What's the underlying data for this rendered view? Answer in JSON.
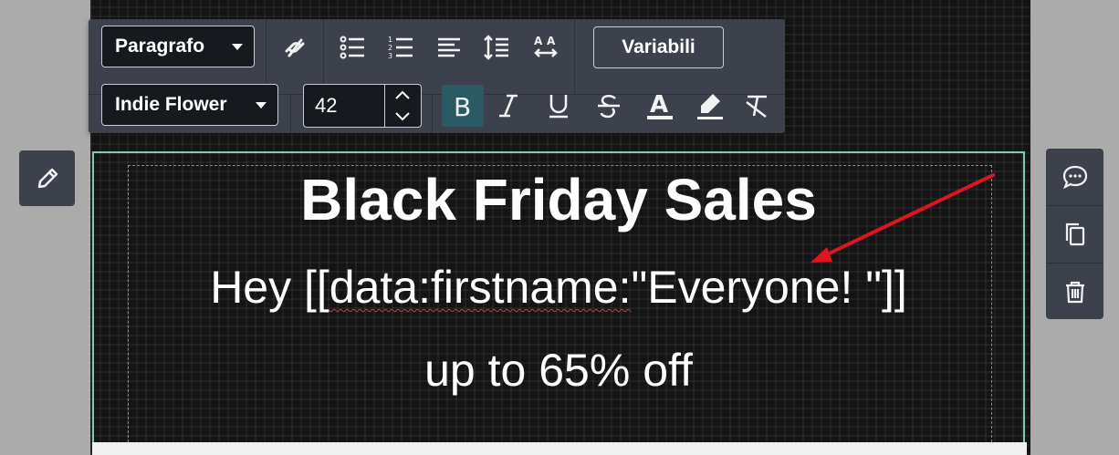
{
  "toolbar": {
    "paragraph_select": "Paragrafo",
    "variables_button": "Variabili",
    "font_select": "Indie Flower",
    "font_size": "42"
  },
  "content": {
    "headline": "Black Friday Sales",
    "greeting_prefix": "Hey [[",
    "greeting_var": "data:firstname:",
    "greeting_suffix": "\"Everyone! \"]]",
    "offer": "up to 65% off"
  },
  "icons": {
    "link": "link-off-icon",
    "bullet_list": "bullet-list-icon",
    "numbered_list": "numbered-list-icon",
    "align": "align-left-icon",
    "line_height": "line-height-icon",
    "text_direction": "text-direction-icon",
    "bold": "bold-icon",
    "italic": "italic-icon",
    "underline": "underline-icon",
    "strikethrough": "strikethrough-icon",
    "text_color": "text-color-icon",
    "highlight": "highlight-icon",
    "clear_format": "clear-format-icon",
    "edit": "pencil-icon",
    "comment": "comment-icon",
    "duplicate": "duplicate-icon",
    "delete": "trash-icon"
  },
  "colors": {
    "toolbar_bg": "#3c414c",
    "selection_border": "#7fc7b6",
    "bold_active": "#2a5a62",
    "annotation_arrow": "#e0141e"
  }
}
